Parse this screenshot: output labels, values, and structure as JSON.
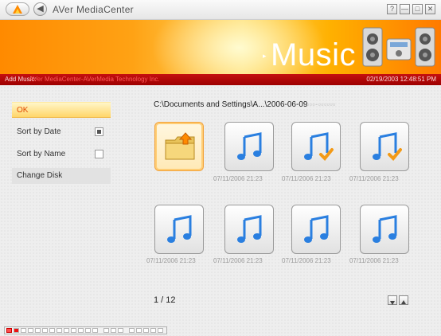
{
  "window": {
    "title": "AVer MediaCenter",
    "buttons": [
      "?",
      "—",
      "□",
      "✕"
    ]
  },
  "banner": {
    "title": "Music"
  },
  "infobar": {
    "label": "Add Music:",
    "value": "AVer MediaCenter-AVerMedia Technology Inc.",
    "timestamp": "02/19/2003 12:48:51 PM"
  },
  "sidebar": {
    "items": [
      {
        "label": "OK"
      },
      {
        "label": "Sort by Date"
      },
      {
        "label": "Sort by Name"
      },
      {
        "label": "Change Disk"
      }
    ]
  },
  "path": {
    "text": "C:\\Documents and Settings\\A...\\2006-06-09",
    "tail": "▫▫▫-▫▫▫▫▫▫"
  },
  "files": [
    {
      "type": "folder-up",
      "date": ""
    },
    {
      "type": "music",
      "date": "07/11/2006 21:23"
    },
    {
      "type": "music-checked",
      "date": "07/11/2006 21:23"
    },
    {
      "type": "music-checked",
      "date": "07/11/2006 21:23"
    },
    {
      "type": "music",
      "date": "07/11/2006 21:23"
    },
    {
      "type": "music",
      "date": "07/11/2006 21:23"
    },
    {
      "type": "music",
      "date": "07/11/2006 21:23"
    },
    {
      "type": "music",
      "date": "07/11/2006 21:23"
    }
  ],
  "pagination": {
    "text": "1 / 12"
  },
  "colors": {
    "accent_orange": "#ff9a10",
    "infobar_red": "#b80808",
    "note_blue": "#2a7fe0"
  }
}
